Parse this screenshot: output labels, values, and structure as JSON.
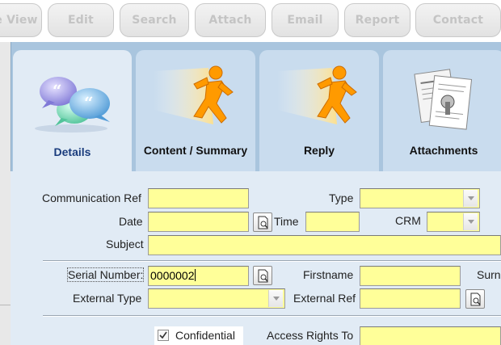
{
  "toolbar": {
    "buttons": [
      {
        "label": "e View"
      },
      {
        "label": "Edit"
      },
      {
        "label": "Search"
      },
      {
        "label": "Attach"
      },
      {
        "label": "Email"
      },
      {
        "label": "Report"
      },
      {
        "label": "Contact"
      }
    ]
  },
  "tabs": [
    {
      "label": "Details",
      "icon": "chat-bubbles-icon"
    },
    {
      "label": "Content / Summary",
      "icon": "running-man-icon"
    },
    {
      "label": "Reply",
      "icon": "running-man-icon"
    },
    {
      "label": "Attachments",
      "icon": "documents-icon"
    }
  ],
  "form": {
    "communication_ref": {
      "label": "Communication Ref",
      "value": ""
    },
    "type": {
      "label": "Type",
      "value": ""
    },
    "date": {
      "label": "Date",
      "value": ""
    },
    "time": {
      "label": "Time",
      "value": ""
    },
    "crm": {
      "label": "CRM",
      "value": ""
    },
    "subject": {
      "label": "Subject",
      "value": ""
    },
    "serial_number": {
      "label": "Serial Number:",
      "value": "0000002"
    },
    "firstname": {
      "label": "Firstname",
      "value": ""
    },
    "surname": {
      "label": "Surn"
    },
    "external_type": {
      "label": "External Type",
      "value": ""
    },
    "external_ref": {
      "label": "External Ref",
      "value": ""
    },
    "confidential": {
      "label": "Confidential",
      "checked": true
    },
    "access_rights": {
      "label": "Access Rights To",
      "value": ""
    }
  },
  "colors": {
    "panel": "#a9c5de",
    "form_bg": "#e1ebf5",
    "field": "#ffff99"
  }
}
